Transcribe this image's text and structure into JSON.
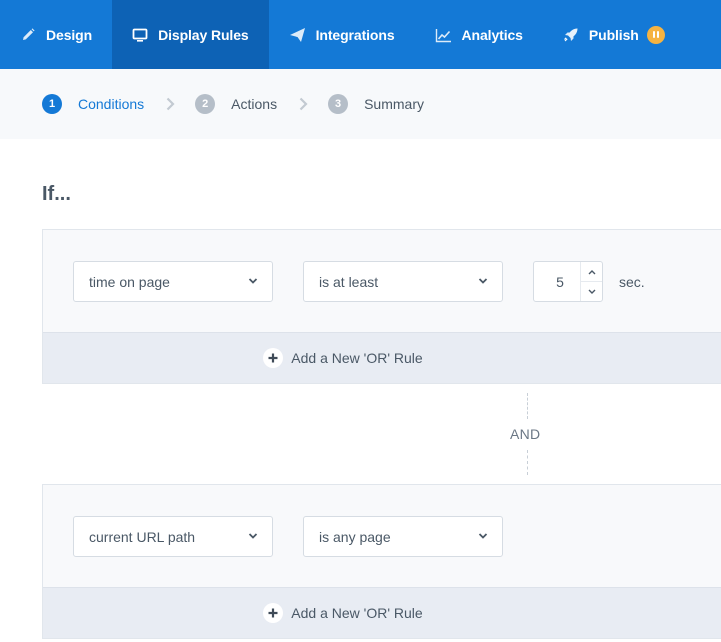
{
  "nav": {
    "items": [
      {
        "label": "Design",
        "icon": "pencil-icon"
      },
      {
        "label": "Display Rules",
        "icon": "monitor-icon",
        "active": true
      },
      {
        "label": "Integrations",
        "icon": "paper-plane-icon"
      },
      {
        "label": "Analytics",
        "icon": "line-chart-icon"
      },
      {
        "label": "Publish",
        "icon": "rocket-icon",
        "badge": "pause-icon"
      }
    ],
    "colors": {
      "bar": "#1479d6",
      "active": "#0d62b5",
      "badge": "#f5b342"
    }
  },
  "stepper": {
    "steps": [
      {
        "number": "1",
        "label": "Conditions",
        "active": true
      },
      {
        "number": "2",
        "label": "Actions"
      },
      {
        "number": "3",
        "label": "Summary"
      }
    ]
  },
  "main": {
    "heading": "If...",
    "groups": [
      {
        "field": "time on page",
        "operator": "is at least",
        "value": "5",
        "unit": "sec.",
        "or_button": "Add a New 'OR' Rule"
      },
      {
        "field": "current URL path",
        "operator": "is any page",
        "or_button": "Add a New 'OR' Rule"
      }
    ],
    "connector": "AND"
  }
}
